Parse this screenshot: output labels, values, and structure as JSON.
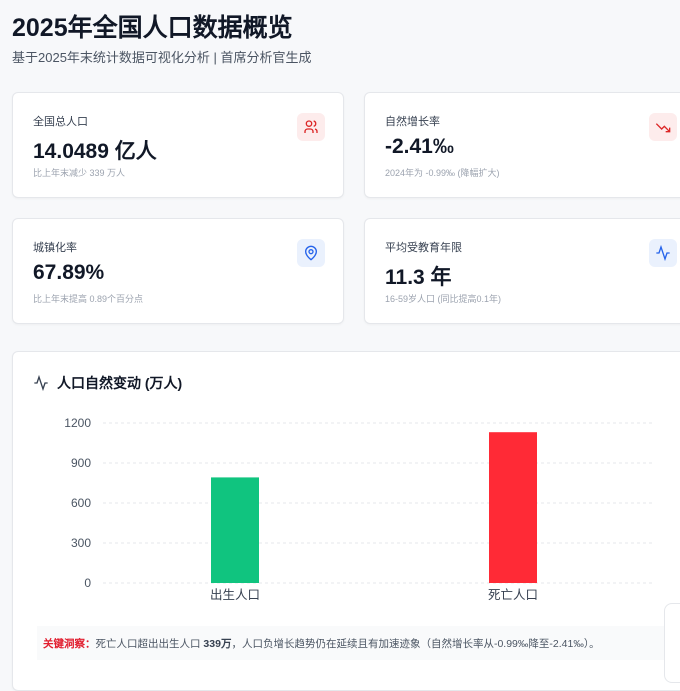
{
  "header": {
    "title": "2025年全国人口数据概览",
    "subtitle": "基于2025年末统计数据可视化分析 | 首席分析官生成"
  },
  "kpis": [
    {
      "label": "全国总人口",
      "value": "14.0489 亿人",
      "note": "比上年末减少 339 万人",
      "icon": "users-icon",
      "color": "#dc2626"
    },
    {
      "label": "自然增长率",
      "value": "-2.41‰",
      "note": "2024年为 -0.99‰ (降幅扩大)",
      "icon": "trending-down-icon",
      "color": "#dc2626"
    },
    {
      "label": "城镇化率",
      "value": "67.89%",
      "note": "比上年末提高 0.89个百分点",
      "icon": "map-pin-icon",
      "color": "#2563eb"
    },
    {
      "label": "平均受教育年限",
      "value": "11.3 年",
      "note": "16-59岁人口 (同比提高0.1年)",
      "icon": "activity-icon",
      "color": "#2563eb"
    }
  ],
  "chart_data": {
    "type": "bar",
    "title": "人口自然变动 (万人)",
    "categories": [
      "出生人口",
      "死亡人口"
    ],
    "values": [
      792,
      1131
    ],
    "colors": [
      "#10c47f",
      "#ff2a36"
    ],
    "yticks": [
      0,
      300,
      600,
      900,
      1200
    ],
    "ylim": [
      0,
      1200
    ],
    "grid": true
  },
  "insight": {
    "key": "关键洞察：",
    "pre": "死亡人口超出出生人口 ",
    "bold": "339万",
    "post": "，人口负增长趋势仍在延续且有加速迹象（自然增长率从-0.99‰降至-2.41‰）。"
  }
}
